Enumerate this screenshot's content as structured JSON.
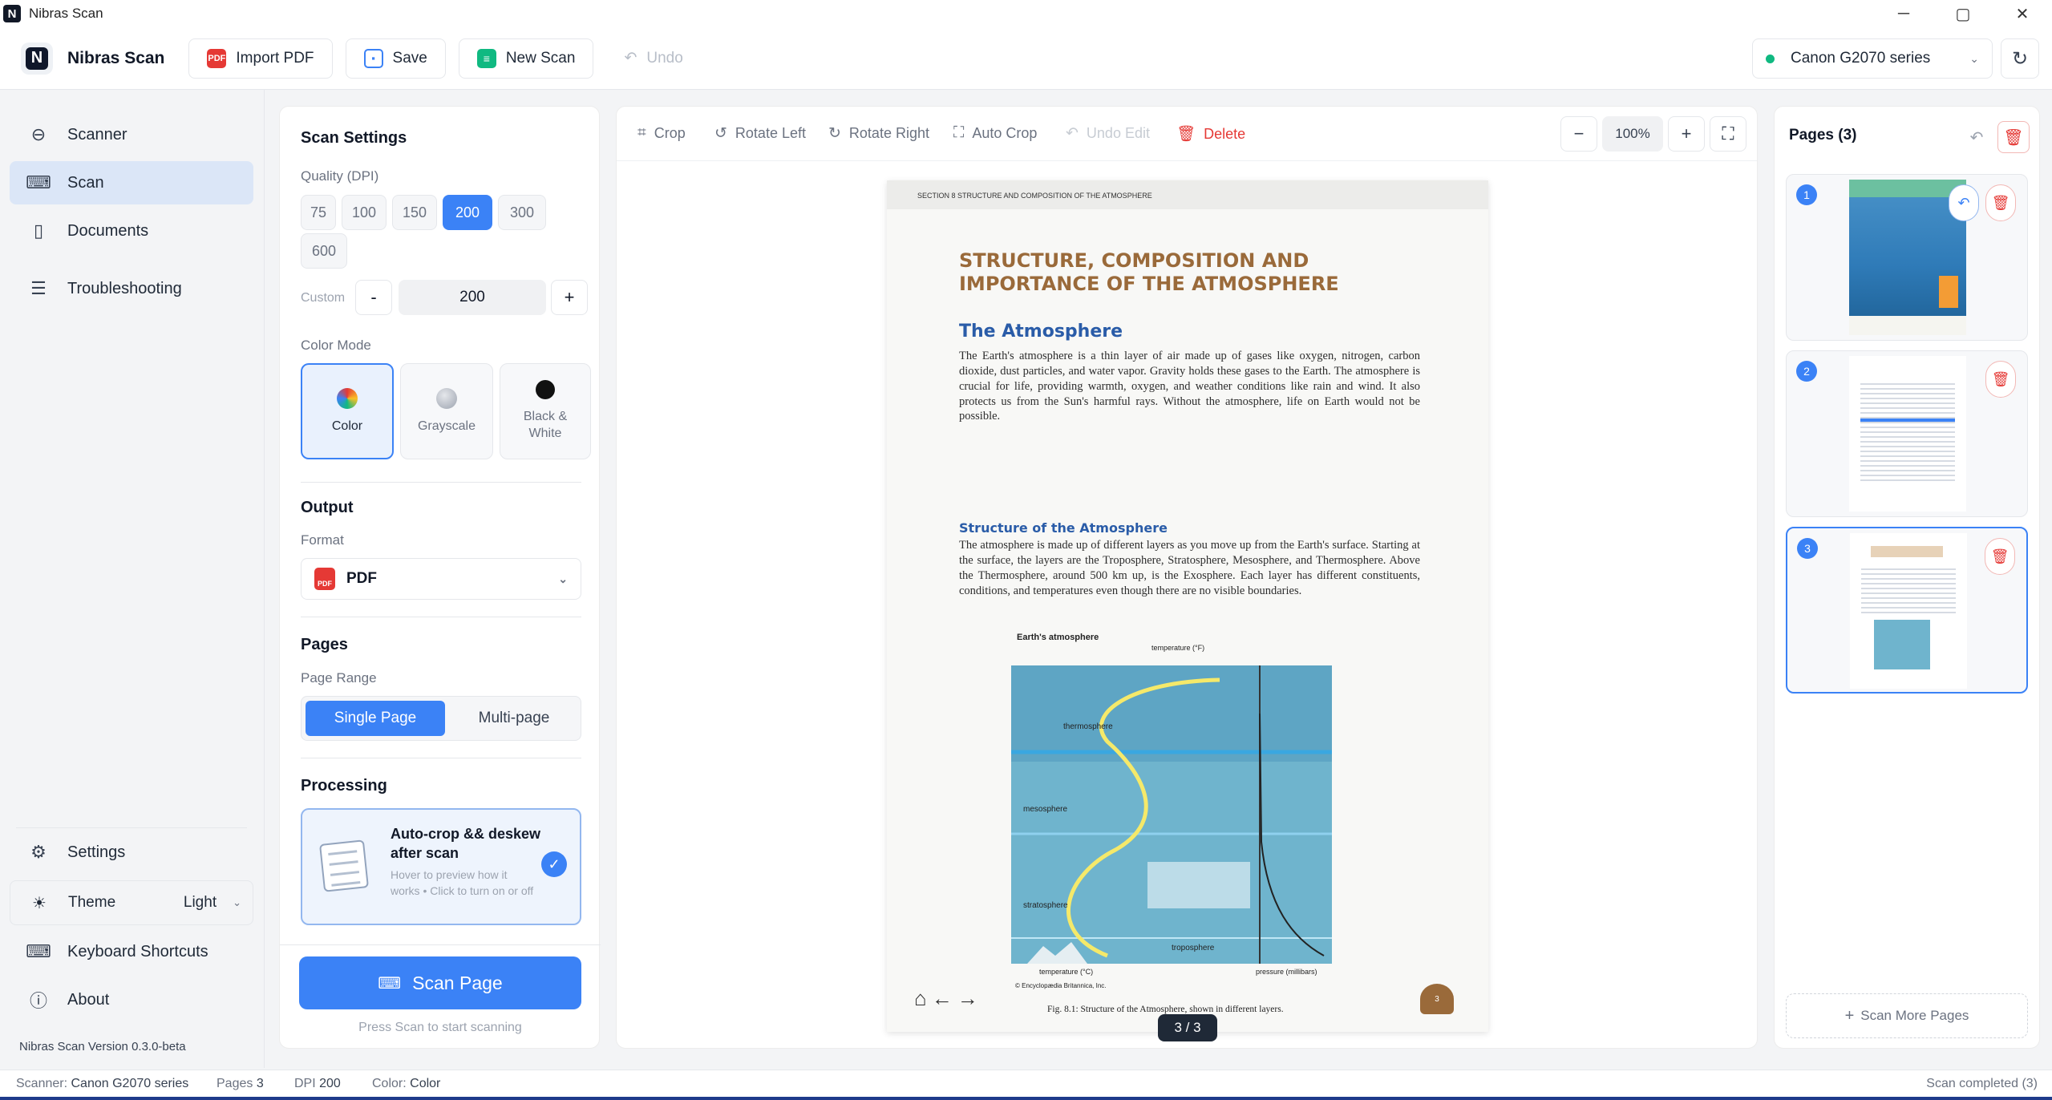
{
  "window": {
    "title": "Nibras Scan",
    "icon_letter": "N"
  },
  "toolbar": {
    "brand": "Nibras Scan",
    "import_label": "Import PDF",
    "save_label": "Save",
    "new_scan_label": "New Scan",
    "undo_label": "Undo",
    "scanner_name": "Canon G2070 series"
  },
  "nav": {
    "scanner": "Scanner",
    "scan": "Scan",
    "documents": "Documents",
    "troubleshooting": "Troubleshooting",
    "settings": "Settings",
    "theme_label": "Theme",
    "theme_value": "Light",
    "shortcuts": "Keyboard Shortcuts",
    "about": "About",
    "version": "Nibras Scan Version 0.3.0-beta"
  },
  "settings": {
    "title": "Scan Settings",
    "quality_label": "Quality (DPI)",
    "dpi_options": [
      "75",
      "100",
      "150",
      "200",
      "300",
      "600"
    ],
    "dpi_selected": "200",
    "custom_label": "Custom",
    "custom_minus": "-",
    "custom_value": "200",
    "custom_plus": "+",
    "color_mode_label": "Color Mode",
    "modes": [
      "Color",
      "Grayscale",
      "Black & White"
    ],
    "output_title": "Output",
    "format_label": "Format",
    "format_value": "PDF",
    "pages_title": "Pages",
    "page_range_label": "Page Range",
    "single_page": "Single Page",
    "multi_page": "Multi-page",
    "processing_title": "Processing",
    "proc_title": "Auto-crop && deskew after scan",
    "proc_desc": "Hover to preview how it works • Click to turn on or off",
    "scan_button": "Scan Page",
    "scan_hint": "Press Scan to start scanning"
  },
  "preview": {
    "tools": {
      "crop": "Crop",
      "rotate_left": "Rotate Left",
      "rotate_right": "Rotate Right",
      "auto_crop": "Auto Crop",
      "undo_edit": "Undo Edit",
      "delete": "Delete"
    },
    "zoom": "100%",
    "counter": "3 / 3",
    "document": {
      "header": "SECTION 8   STRUCTURE AND COMPOSITION OF THE ATMOSPHERE",
      "title": "STRUCTURE, COMPOSITION AND IMPORTANCE OF THE ATMOSPHERE",
      "h2": "The Atmosphere",
      "p1": "The Earth's atmosphere is a thin layer of air made up of gases like oxygen, nitrogen, carbon dioxide, dust particles, and water vapor. Gravity holds these gases to the Earth. The atmosphere is crucial for life, providing warmth, oxygen, and weather conditions like rain and wind. It also protects us from the Sun's harmful rays. Without the atmosphere, life on Earth would not be possible.",
      "h3": "Structure of the Atmosphere",
      "p2": "The atmosphere is made up of different layers as you move up from the Earth's surface. Starting at the surface, the layers are the Troposphere, Stratosphere, Mesosphere, and Thermosphere. Above the Thermosphere, around 500 km up, is the Exosphere. Each layer has different constituents, conditions, and temperatures even though there are no visible boundaries.",
      "chart_title": "Earth's atmosphere",
      "chart_temp_label": "temperature (°F)",
      "chart_layers": [
        "thermosphere",
        "mesosphere",
        "stratosphere",
        "troposphere"
      ],
      "chart_bottom_left": "temperature (°C)",
      "chart_bottom_right": "pressure (millibars)",
      "credit": "© Encyclopædia Britannica, Inc.",
      "caption": "Fig. 8.1: Structure of the Atmosphere, shown in different layers.",
      "page_number": "3"
    }
  },
  "pages_panel": {
    "title": "Pages (3)",
    "items": [
      "1",
      "2",
      "3"
    ],
    "scan_more": "Scan More Pages"
  },
  "status": {
    "scanner_label": "Scanner:",
    "scanner_value": "Canon G2070 series",
    "pages_label": "Pages",
    "pages_value": "3",
    "dpi_label": "DPI",
    "dpi_value": "200",
    "color_label": "Color:",
    "color_value": "Color",
    "right": "Scan completed (3)"
  },
  "colors": {
    "accent": "#3b82f6",
    "danger": "#e53935",
    "success": "#10b981"
  }
}
